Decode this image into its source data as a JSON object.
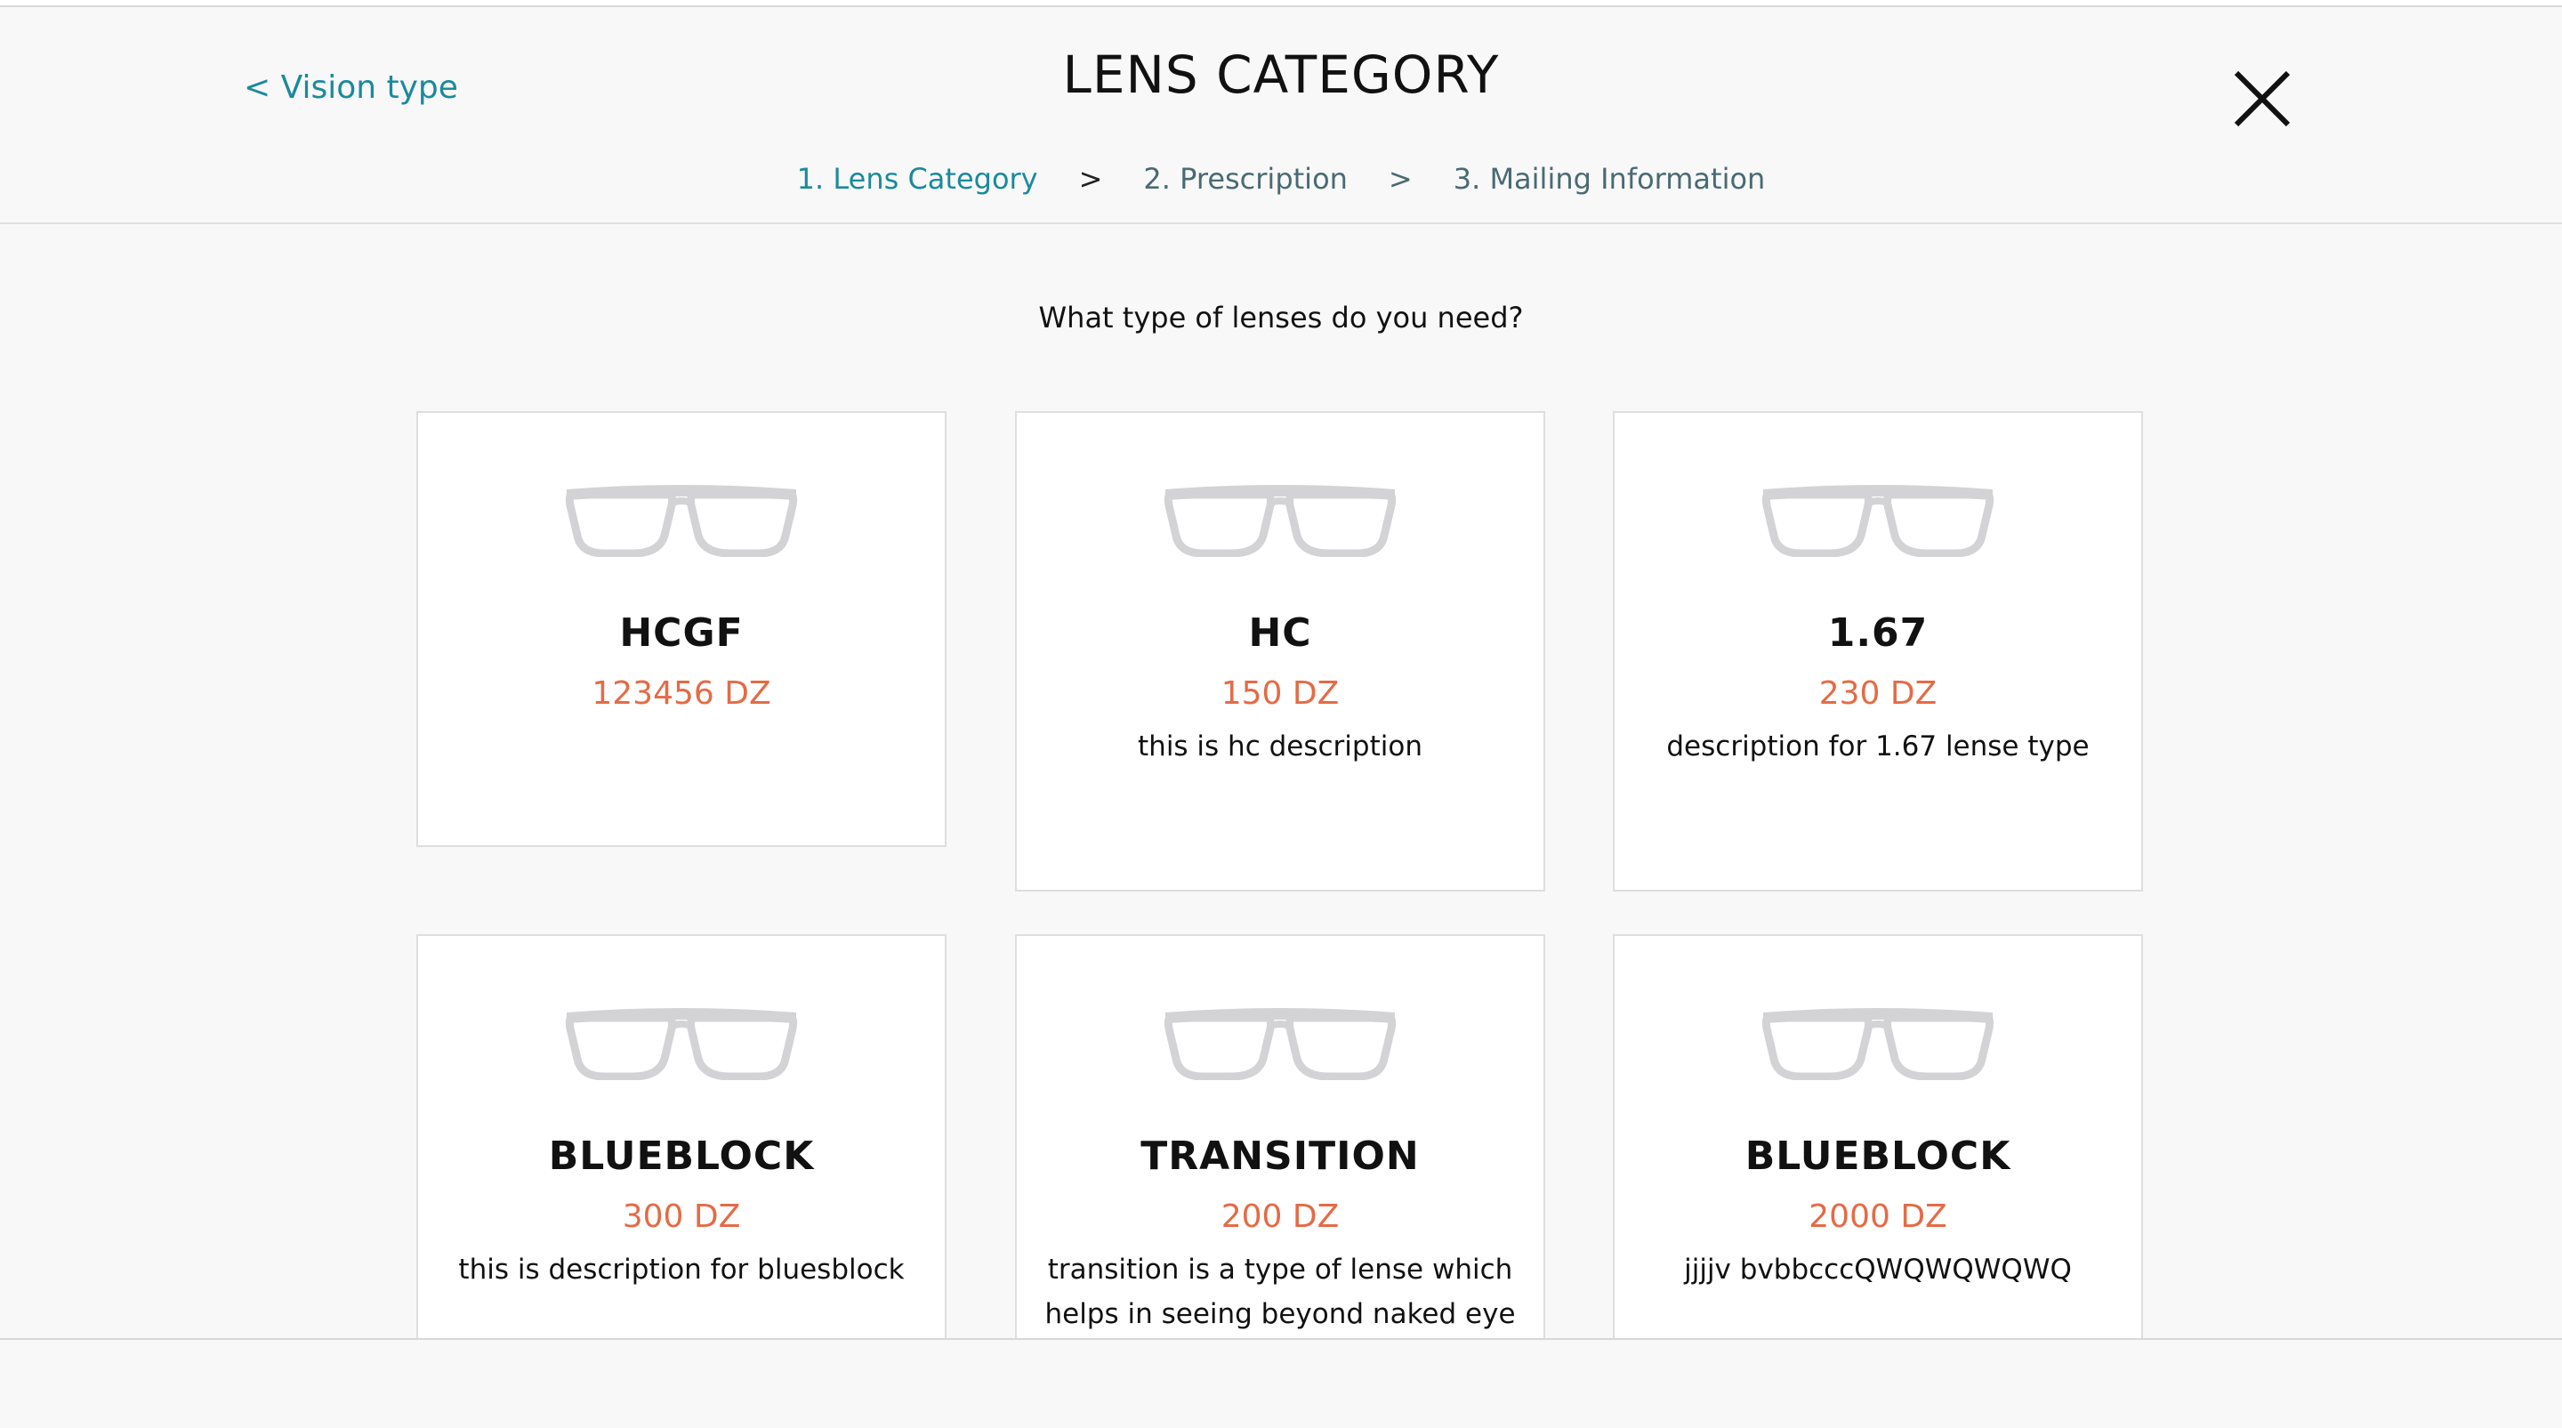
{
  "header": {
    "back_label": "< Vision type",
    "title": "LENS CATEGORY",
    "close_icon": "close-icon"
  },
  "steps": [
    {
      "label": "1. Lens Category",
      "active": true
    },
    {
      "label": "2. Prescription",
      "active": false
    },
    {
      "label": "3. Mailing Information",
      "active": false
    }
  ],
  "step_separator": ">",
  "question": "What type of lenses do you need?",
  "cards": [
    {
      "name": "HCGF",
      "price": "123456 DZ",
      "description": "",
      "icon": "glasses-icon"
    },
    {
      "name": "HC",
      "price": "150 DZ",
      "description": "this is hc description",
      "icon": "glasses-icon"
    },
    {
      "name": "1.67",
      "price": "230 DZ",
      "description": "description for 1.67 lense type",
      "icon": "glasses-icon"
    },
    {
      "name": "BLUEBLOCK",
      "price": "300 DZ",
      "description": "this is description for bluesblock",
      "icon": "glasses-icon"
    },
    {
      "name": "TRANSITION",
      "price": "200 DZ",
      "description": "transition is a type of lense which helps in seeing beyond naked eye",
      "icon": "glasses-icon"
    },
    {
      "name": "BLUEBLOCK",
      "price": "2000 DZ",
      "description": "jjjjv bvbbcccQWQWQWQWQ",
      "icon": "glasses-icon"
    }
  ],
  "colors": {
    "accent": "#1a8a9c",
    "price": "#e46b45",
    "glasses": "#d3d3d6"
  }
}
